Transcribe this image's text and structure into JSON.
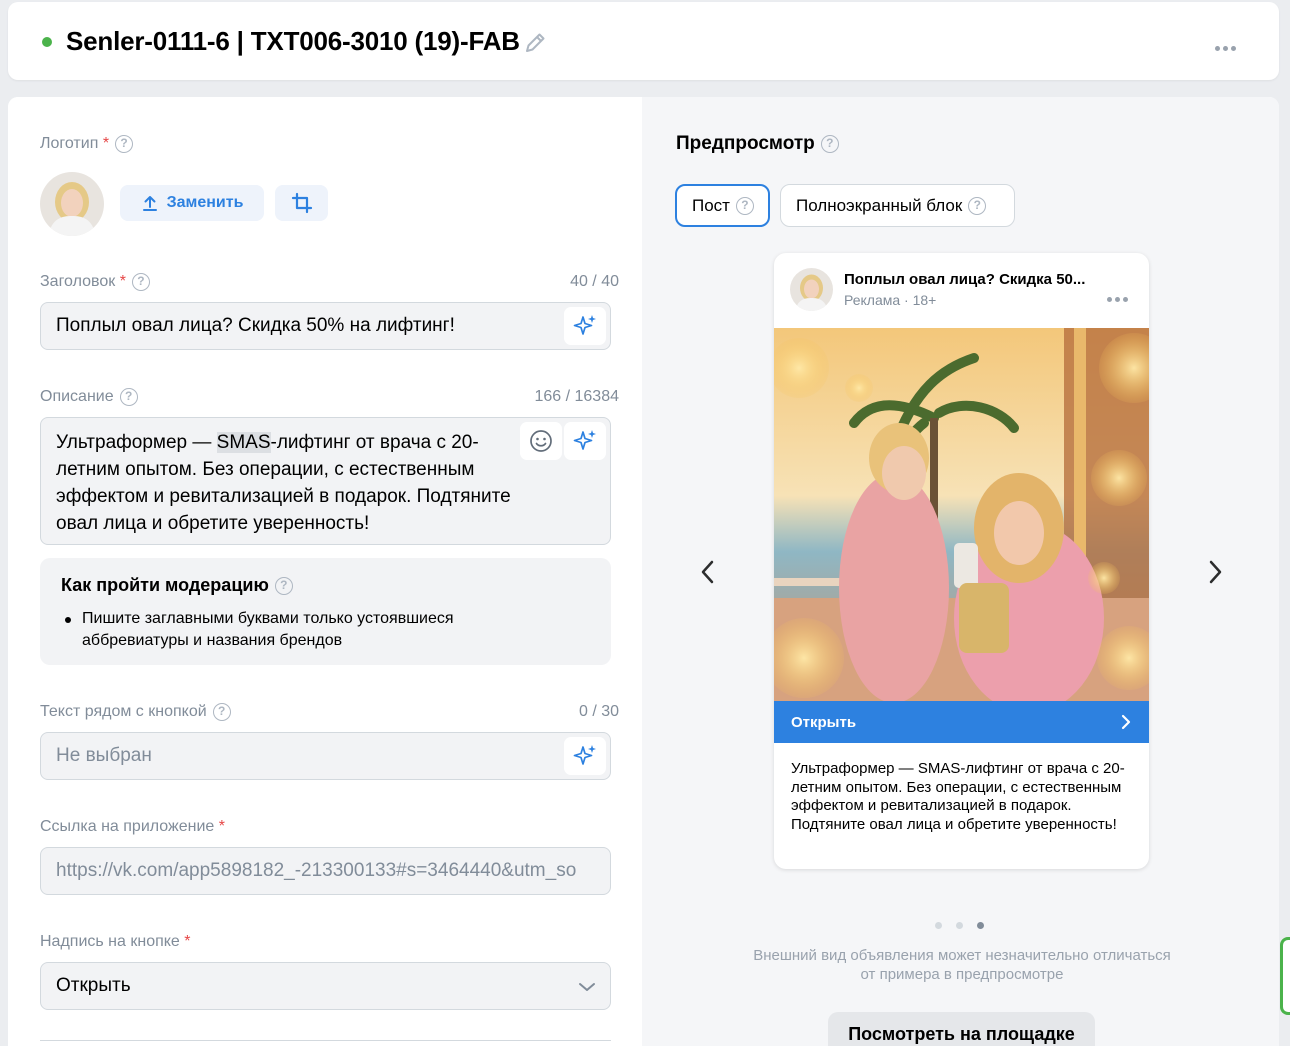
{
  "header": {
    "title": "Senler-0111-6 | TXT006-3010 (19)-FAB",
    "status_color": "#4bb34b"
  },
  "form": {
    "logo": {
      "label": "Логотип",
      "required_mark": "*",
      "replace_label": "Заменить"
    },
    "headline": {
      "label": "Заголовок",
      "required_mark": "*",
      "counter": "40 / 40",
      "value": "Поплыл овал лица? Скидка 50% на лифтинг!"
    },
    "description": {
      "label": "Описание",
      "counter": "166 / 16384",
      "text_before": "Ультраформер — ",
      "text_highlight": "SMAS",
      "text_after": "-лифтинг от врача с 20-летним опытом. Без операции, с естественным эффектом и ревитализацией в подарок. Подтяните овал лица и обретите уверенность!"
    },
    "moderation": {
      "title": "Как пройти модерацию",
      "items": [
        "Пишите заглавными буквами только устоявшиеся аббревиатуры и названия брендов"
      ]
    },
    "button_text": {
      "label": "Текст рядом с кнопкой",
      "counter": "0 / 30",
      "placeholder": "Не выбран"
    },
    "app_link": {
      "label": "Ссылка на приложение",
      "required_mark": "*",
      "value": "https://vk.com/app5898182_-213300133#s=3464440&utm_so"
    },
    "button_caption": {
      "label": "Надпись на кнопке",
      "required_mark": "*",
      "value": "Открыть"
    }
  },
  "preview": {
    "title": "Предпросмотр",
    "tabs": [
      {
        "label": "Пост",
        "active": true
      },
      {
        "label": "Полноэкранный блок",
        "active": false
      }
    ],
    "post": {
      "title": "Поплыл овал лица? Скидка 50...",
      "subtitle": "Реклама · 18+",
      "cta": "Открыть",
      "text": "Ультраформер — SMAS-лифтинг от врача с 20-летним опытом. Без операции, с естественным эффектом и ревитализацией в подарок. Подтяните овал лица и обретите уверенность!"
    },
    "carousel": {
      "count": 3,
      "active_index": 2
    },
    "note": "Внешний вид объявления может незначительно отличаться от примера в предпросмотре",
    "view_button": "Посмотреть на площадке"
  },
  "colors": {
    "accent": "#2d81e0",
    "required": "#e64646",
    "status_green": "#4bb34b"
  }
}
